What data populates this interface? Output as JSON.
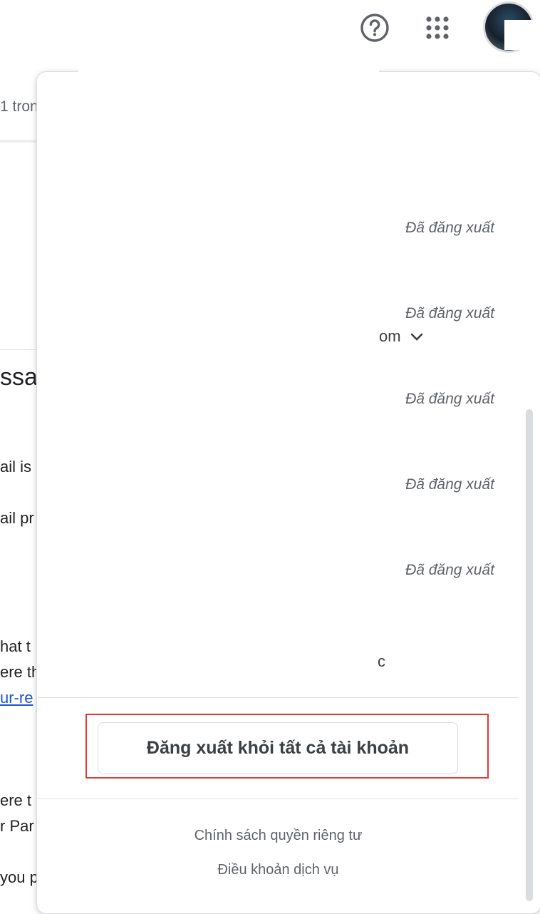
{
  "background": {
    "count_text": "1 tron",
    "heading": "ssa",
    "lines": [
      "ail is",
      "ail pr",
      "hat t",
      "ere th",
      "ur-re",
      "ere t",
      "r Par",
      "you p"
    ]
  },
  "accounts": [
    {
      "status": "Đã đăng xuất"
    },
    {
      "status": "Đã đăng xuất",
      "email_fragment": "om"
    },
    {
      "status": "Đã đăng xuất"
    },
    {
      "status": "Đã đăng xuất"
    },
    {
      "status": "Đã đăng xuất"
    }
  ],
  "partial_text": "c",
  "signout_all_label": "Đăng xuất khỏi tất cả tài khoản",
  "footer": {
    "privacy": "Chính sách quyền riêng tư",
    "terms": "Điều khoản dịch vụ"
  },
  "colors": {
    "highlight": "#e53935",
    "link": "#1a56c8"
  },
  "icons": [
    "help-icon",
    "apps-grid-icon",
    "chevron-down-icon"
  ]
}
